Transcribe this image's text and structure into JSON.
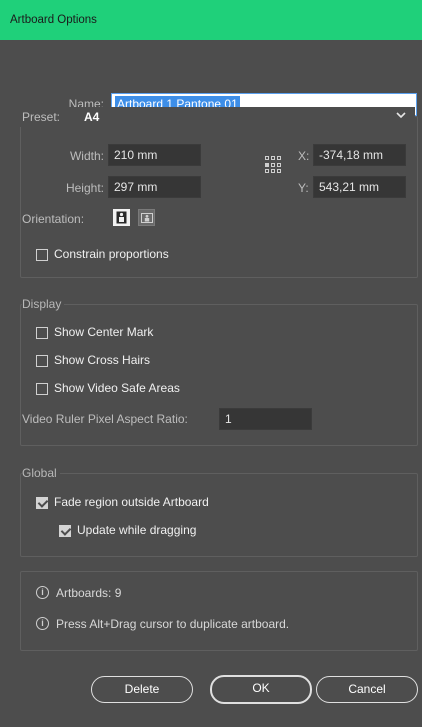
{
  "window": {
    "title": "Artboard Options"
  },
  "name": {
    "label": "Name:",
    "value": "Artboard 1 Pantone 01"
  },
  "preset": {
    "label": "Preset:",
    "value": "A4"
  },
  "size": {
    "width_label": "Width:",
    "width_value": "210 mm",
    "height_label": "Height:",
    "height_value": "297 mm",
    "x_label": "X:",
    "x_value": "-374,18 mm",
    "y_label": "Y:",
    "y_value": "543,21 mm"
  },
  "orientation": {
    "label": "Orientation:",
    "selected": "portrait"
  },
  "constrain": {
    "label": "Constrain proportions",
    "checked": false
  },
  "display": {
    "title": "Display",
    "center_mark": {
      "label": "Show Center Mark",
      "checked": false
    },
    "cross_hairs": {
      "label": "Show Cross Hairs",
      "checked": false
    },
    "video_safe": {
      "label": "Show Video Safe Areas",
      "checked": false
    },
    "ratio_label": "Video Ruler Pixel Aspect Ratio:",
    "ratio_value": "1"
  },
  "global": {
    "title": "Global",
    "fade": {
      "label": "Fade region outside Artboard",
      "checked": true
    },
    "update": {
      "label": "Update while dragging",
      "checked": true
    }
  },
  "info": {
    "artboards": "Artboards: 9",
    "hint": "Press Alt+Drag cursor to duplicate artboard."
  },
  "buttons": {
    "delete": "Delete",
    "ok": "OK",
    "cancel": "Cancel"
  },
  "colors": {
    "title_bar": "#1fd07a",
    "background": "#4d4d4d",
    "field": "#363636",
    "selection": "#3d8ee8"
  }
}
